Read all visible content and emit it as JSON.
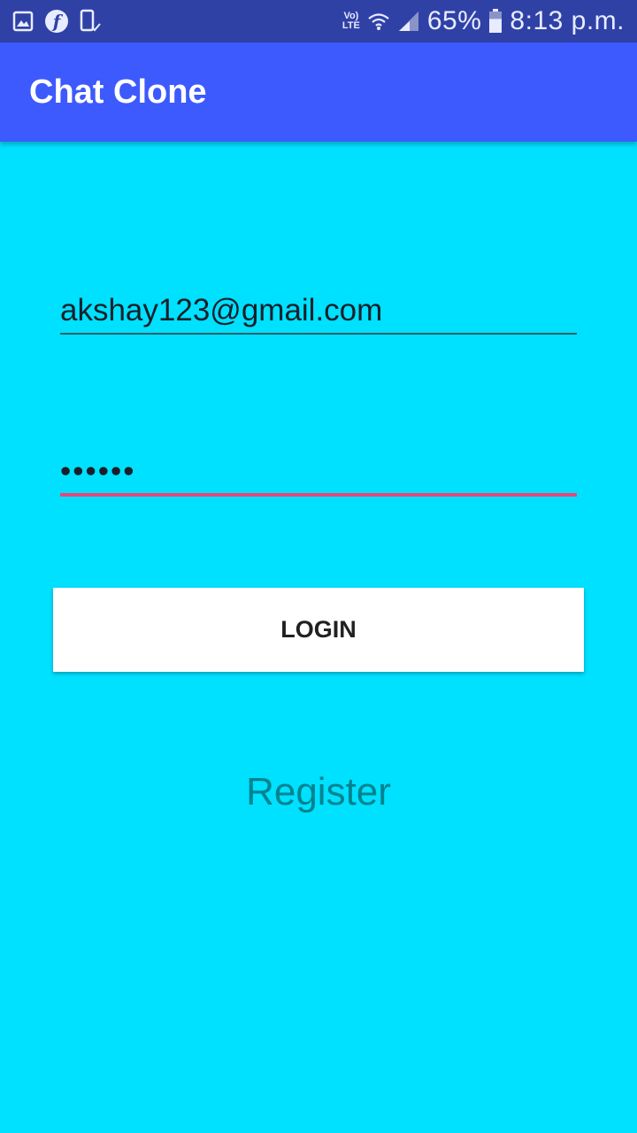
{
  "status_bar": {
    "icons_left": [
      "gallery-icon",
      "flipkart-icon",
      "phone-check-icon"
    ],
    "volte_line1": "Vo)",
    "volte_line2": "LTE",
    "battery_percent": "65%",
    "battery_level": 0.65,
    "time": "8:13 p.m."
  },
  "app_bar": {
    "title": "Chat Clone"
  },
  "login_form": {
    "email_value": "akshay123@gmail.com",
    "password_value": "••••••",
    "login_label": "LOGIN",
    "register_label": "Register"
  },
  "colors": {
    "status_bar": "#3041A6",
    "app_bar": "#3D5AFE",
    "background": "#00E0FF",
    "focused_underline": "#E8477A",
    "register_text": "#00838F"
  }
}
